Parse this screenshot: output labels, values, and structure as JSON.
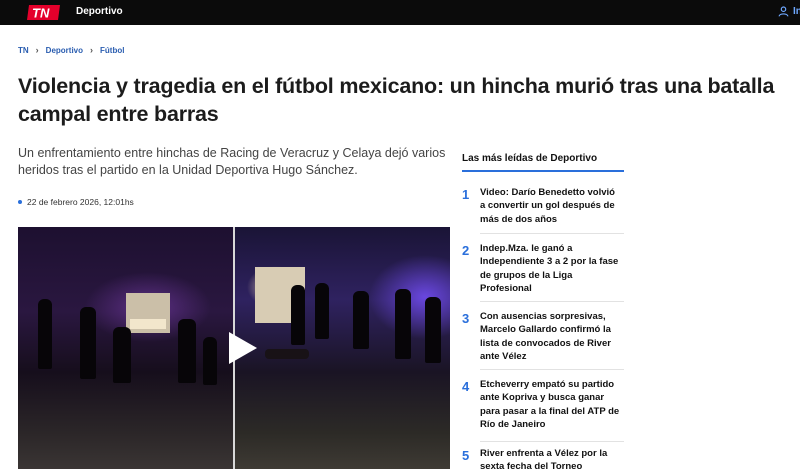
{
  "header": {
    "logo_text": "TN",
    "section": "Deportivo",
    "login_label": "In"
  },
  "breadcrumb": [
    "TN",
    "Deportivo",
    "Fútbol"
  ],
  "article": {
    "title": "Violencia y tragedia en el fútbol mexicano: un hincha murió tras una batalla campal entre barras",
    "summary": "Un enfrentamiento entre hinchas de Racing de Veracruz y Celaya dejó varios heridos tras el partido en la Unidad Deportiva Hugo Sánchez.",
    "date": "22 de febrero 2026, 12:01hs"
  },
  "most_read": {
    "title": "Las más leídas de Deportivo",
    "items": [
      {
        "num": "1",
        "text": "Video: Darío Benedetto volvió a convertir un gol después de más de dos años"
      },
      {
        "num": "2",
        "text": "Indep.Mza. le ganó a Independiente 3 a 2 por la fase de grupos de la Liga Profesional"
      },
      {
        "num": "3",
        "text": "Con ausencias sorpresivas, Marcelo Gallardo confirmó la lista de convocados de River ante Vélez"
      },
      {
        "num": "4",
        "text": "Etcheverry empató su partido ante Kopriva y busca ganar para pasar a la final del ATP de Río de Janeiro"
      },
      {
        "num": "5",
        "text": "River enfrenta a Vélez por la sexta fecha del Torneo"
      }
    ]
  },
  "colors": {
    "topbar": "#0b0b0b",
    "accent_blue": "#2a6fdb",
    "logo_red": "#e4002b"
  },
  "icons": {
    "logo": "tn-logo-icon",
    "user": "user-icon",
    "chevron": "chevron-right-icon",
    "play": "play-icon"
  }
}
